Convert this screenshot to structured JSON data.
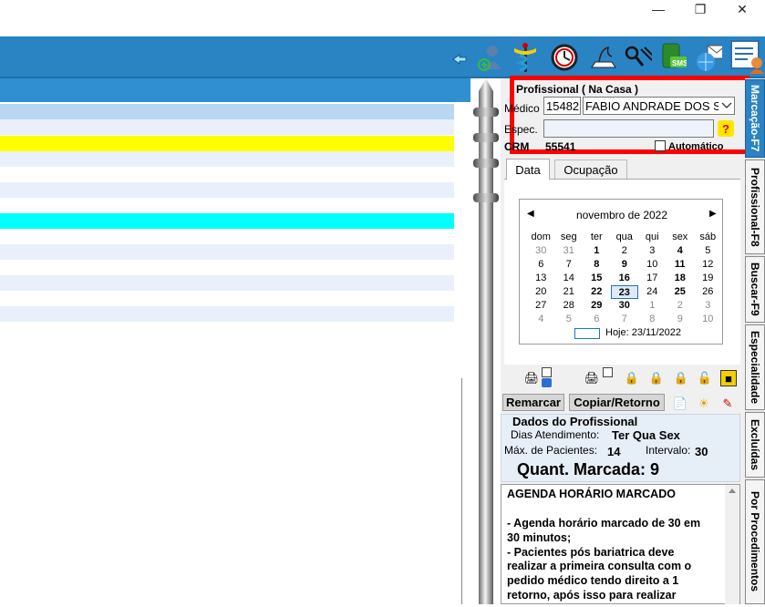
{
  "window": {
    "minimize_icon": "minimize-icon",
    "restore_icon": "restore-icon",
    "close_icon": "close-icon"
  },
  "toolbar": {
    "icons": [
      "back-arrow-icon",
      "user-add-icon",
      "medical-caduceus-icon",
      "clock-icon",
      "document-sign-icon",
      "tools-icon",
      "sms-phone-icon",
      "email-globe-icon",
      "doctor-report-icon"
    ]
  },
  "professional": {
    "title": "Profissional ( Na Casa )",
    "medico_label": "Médico",
    "medico_code": "15482",
    "medico_name": "FABIO ANDRADE DOS S",
    "espec_label": "Espec.",
    "espec_value": "",
    "crm_label": "CRM",
    "crm_value": "55541",
    "automatico_label": "Automático"
  },
  "tabs": {
    "data": "Data",
    "ocupacao": "Ocupação"
  },
  "calendar": {
    "month_label": "novembro de 2022",
    "weekdays": [
      "dom",
      "seg",
      "ter",
      "qua",
      "qui",
      "sex",
      "sáb"
    ],
    "weeks": [
      [
        "30",
        "31",
        "1",
        "2",
        "3",
        "4",
        "5"
      ],
      [
        "6",
        "7",
        "8",
        "9",
        "10",
        "11",
        "12"
      ],
      [
        "13",
        "14",
        "15",
        "16",
        "17",
        "18",
        "19"
      ],
      [
        "20",
        "21",
        "22",
        "23",
        "24",
        "25",
        "26"
      ],
      [
        "27",
        "28",
        "29",
        "30",
        "1",
        "2",
        "3"
      ],
      [
        "4",
        "5",
        "6",
        "7",
        "8",
        "9",
        "10"
      ]
    ],
    "today_label": "Hoje: 23/11/2022"
  },
  "actions": {
    "remarcar": "Remarcar",
    "copiar_retorno": "Copiar/Retorno"
  },
  "dados": {
    "title": "Dados do Profissional",
    "dias_label": "Dias Atendimento:",
    "dias_value": "Ter Qua Sex",
    "max_label": "Máx. de Pacientes:",
    "max_value": "14",
    "intervalo_label": "Intervalo:",
    "intervalo_value": "30",
    "quant_label": "Quant. Marcada: 9"
  },
  "notes": {
    "line1": "AGENDA HORÁRIO MARCADO",
    "line2": "- Agenda horário marcado de 30 em",
    "line3": "30 minutos;",
    "line4": "- Pacientes pós bariatrica deve",
    "line5": "realizar a primeira consulta com o",
    "line6": "pedido médico tendo direito a 1",
    "line7": "retorno, após isso para realizar"
  },
  "vertical_tabs": [
    "Marcação-F7",
    "Profissional-F8",
    "Buscar-F9",
    "Especialidade",
    "Excluídas",
    "Por Procedimentos"
  ],
  "colors": {
    "toolbar": "#2a83c3",
    "highlight_yellow": "#ffff00",
    "highlight_cyan": "#00ffff",
    "accent_red": "#ff0000"
  }
}
